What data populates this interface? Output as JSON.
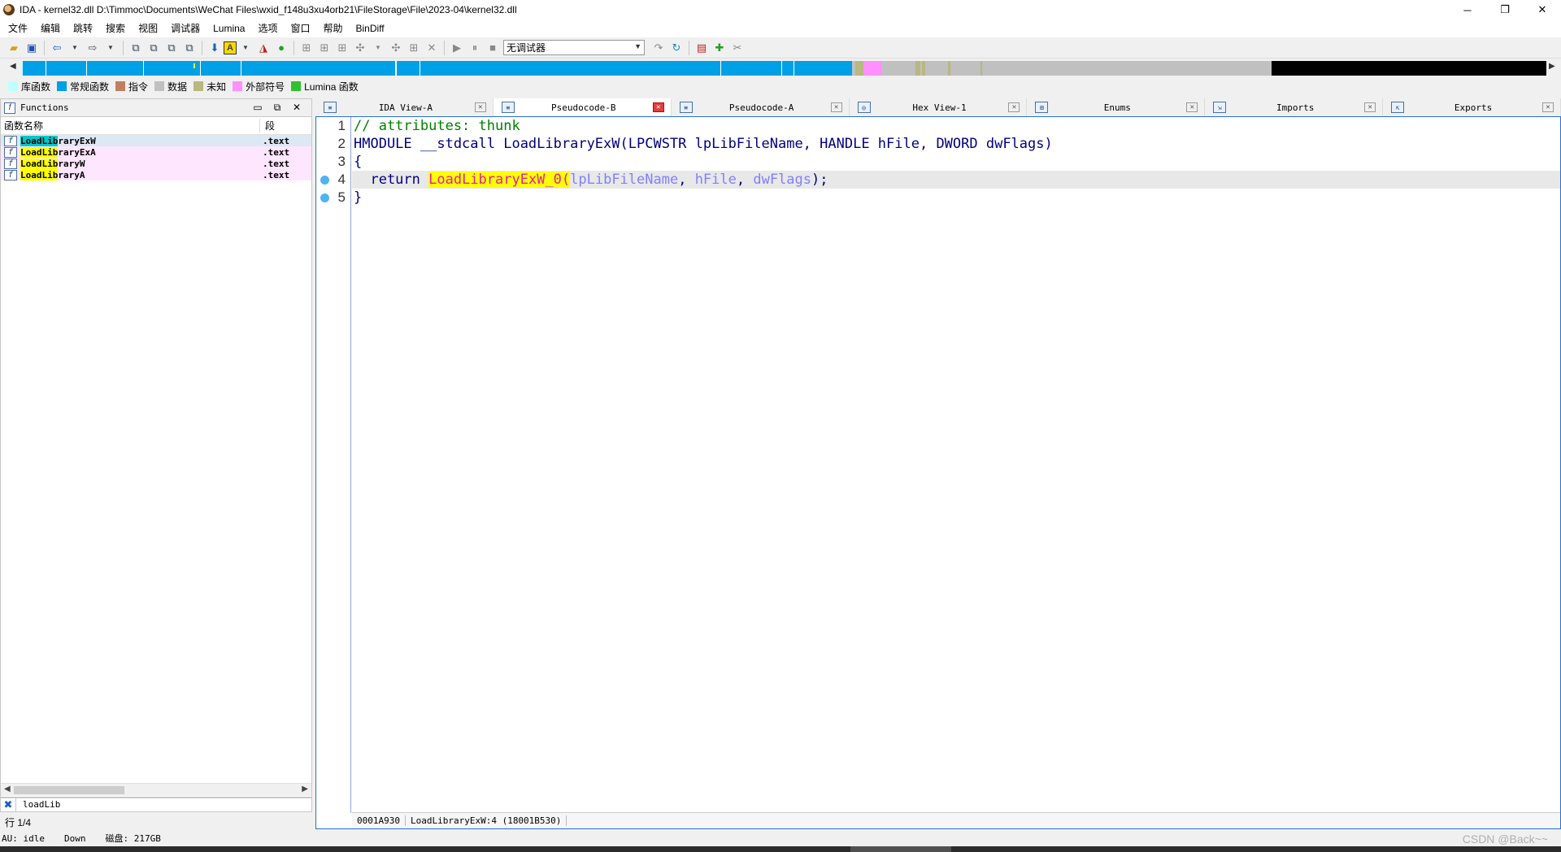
{
  "window": {
    "title": "IDA - kernel32.dll D:\\Timmoc\\Documents\\WeChat Files\\wxid_f148u3xu4orb21\\FileStorage\\File\\2023-04\\kernel32.dll",
    "minimize": "─",
    "maximize": "❐",
    "close": "✕"
  },
  "menu": [
    "文件",
    "编辑",
    "跳转",
    "搜索",
    "视图",
    "调试器",
    "Lumina",
    "选项",
    "窗口",
    "帮助",
    "BinDiff"
  ],
  "toolbar": {
    "debugger_select": "无调试器"
  },
  "legend": [
    {
      "label": "库函数",
      "color": "#c0ffff"
    },
    {
      "label": "常规函数",
      "color": "#00a0e6"
    },
    {
      "label": "指令",
      "color": "#c08060"
    },
    {
      "label": "数据",
      "color": "#c0c0c0"
    },
    {
      "label": "未知",
      "color": "#b8b880"
    },
    {
      "label": "外部符号",
      "color": "#ff90ff"
    },
    {
      "label": "Lumina 函数",
      "color": "#30c030"
    }
  ],
  "functions_panel": {
    "title": "Functions",
    "col_name": "函数名称",
    "col_segment": "段",
    "rows": [
      {
        "match": "LoadLib",
        "rest": "raryExW",
        "segment": ".text"
      },
      {
        "match": "LoadLib",
        "rest": "raryExA",
        "segment": ".text"
      },
      {
        "match": "LoadLib",
        "rest": "raryW",
        "segment": ".text"
      },
      {
        "match": "LoadLib",
        "rest": "raryA",
        "segment": ".text"
      }
    ],
    "filter_value": "loadLib",
    "row_count": "行 1/4"
  },
  "tabs": [
    {
      "label": "IDA View-A",
      "icon": "disassembly-icon"
    },
    {
      "label": "Pseudocode-B",
      "icon": "pseudocode-icon"
    },
    {
      "label": "Pseudocode-A",
      "icon": "pseudocode-icon"
    },
    {
      "label": "Hex View-1",
      "icon": "hex-icon"
    },
    {
      "label": "Enums",
      "icon": "enum-icon"
    },
    {
      "label": "Imports",
      "icon": "imports-icon"
    },
    {
      "label": "Exports",
      "icon": "exports-icon"
    }
  ],
  "code": {
    "line_numbers": [
      "1",
      "2",
      "3",
      "4",
      "5"
    ],
    "line1": "// attributes: thunk",
    "line2": "HMODULE __stdcall LoadLibraryExW(LPCWSTR lpLibFileName, HANDLE hFile, DWORD dwFlags)",
    "line3": "{",
    "line4_kw": "  return ",
    "line4_call": "LoadLibraryExW_0",
    "line4_open": "(",
    "line4_a1": "lpLibFileName",
    "line4_sep1": ", ",
    "line4_a2": "hFile",
    "line4_sep2": ", ",
    "line4_a3": "dwFlags",
    "line4_close": ");",
    "line5": "}",
    "status_addr": "0001A930",
    "status_loc": "LoadLibraryExW:4 (18001B530)"
  },
  "status": {
    "au": "AU:  idle",
    "dir": "Down",
    "disk": "磁盘: 217GB"
  },
  "watermark": "CSDN @Back~~"
}
